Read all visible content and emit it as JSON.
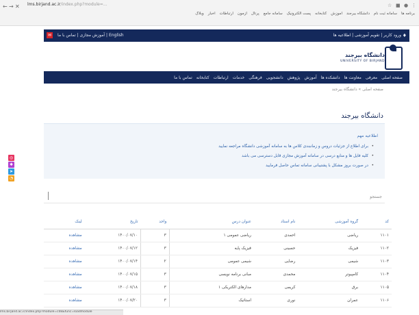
{
  "browser": {
    "url_host": "lms.birjand.ac.ir",
    "url_path": "/index.php?module=...",
    "bookmarks": [
      "برنامه ها",
      "سامانه ثبت نام",
      "دانشگاه بیرجند",
      "آموزش",
      "کتابخانه",
      "پست الکترونیک",
      "سامانه جامع",
      "پرتال",
      "آزمون",
      "ارتباطات",
      "اخبار",
      "وبلاگ"
    ]
  },
  "topbar": {
    "left_links": "آموزش مجازی  |  تماس با ما  |  English",
    "right_links": "ورود کاربر  |  تقویم آموزشی  |  اطلاعیه ها"
  },
  "logo": {
    "name": "دانشگاه بیرجند",
    "latin": "UNIVERSITY OF BIRJAND"
  },
  "mainnav": {
    "items": [
      "صفحه اصلی",
      "معرفی",
      "معاونت ها",
      "دانشکده ها",
      "آموزش",
      "پژوهش",
      "دانشجویی",
      "فرهنگی",
      "خدمات",
      "ارتباطات",
      "کتابخانه",
      "تماس با ما"
    ]
  },
  "breadcrumb": "صفحه اصلی  »  دانشگاه بیرجند",
  "page_title": "دانشگاه بیرجند",
  "notice": {
    "heading": "اطلاعیه مهم",
    "items": [
      "برای اطلاع از جزئیات دروس و زمانبندی کلاس ها به سامانه آموزشی دانشگاه مراجعه نمایید",
      "کلیه فایل ها و منابع درسی در سامانه آموزش مجازی قابل دسترسی می باشد",
      "در صورت بروز مشکل با پشتیبانی سامانه تماس حاصل فرمایید"
    ]
  },
  "search": {
    "label": "جستجو"
  },
  "table": {
    "headers": [
      "کد",
      "گروه آموزشی",
      "نام استاد",
      "عنوان درس",
      "واحد",
      "تاریخ",
      "لینک"
    ],
    "rows": [
      [
        "۱۱۰۱",
        "ریاضی",
        "احمدی",
        "ریاضی عمومی ۱",
        "۳",
        "۱۴۰۰/۰۷/۱۰",
        "مشاهده"
      ],
      [
        "۱۱۰۲",
        "فیزیک",
        "حسینی",
        "فیزیک پایه",
        "۳",
        "۱۴۰۰/۰۷/۱۲",
        "مشاهده"
      ],
      [
        "۱۱۰۳",
        "شیمی",
        "رضایی",
        "شیمی عمومی",
        "۲",
        "۱۴۰۰/۰۷/۱۴",
        "مشاهده"
      ],
      [
        "۱۱۰۴",
        "کامپیوتر",
        "محمدی",
        "مبانی برنامه نویسی",
        "۳",
        "۱۴۰۰/۰۷/۱۵",
        "مشاهده"
      ],
      [
        "۱۱۰۵",
        "برق",
        "کریمی",
        "مدارهای الکتریکی ۱",
        "۳",
        "۱۴۰۰/۰۷/۱۸",
        "مشاهده"
      ],
      [
        "۱۱۰۶",
        "عمران",
        "نوری",
        "استاتیک",
        "۳",
        "۱۴۰۰/۰۷/۲۰",
        "مشاهده"
      ]
    ]
  },
  "statusbar": "lms.birjand.ac.ir/index.php?module=cdk&func=loadmodule"
}
